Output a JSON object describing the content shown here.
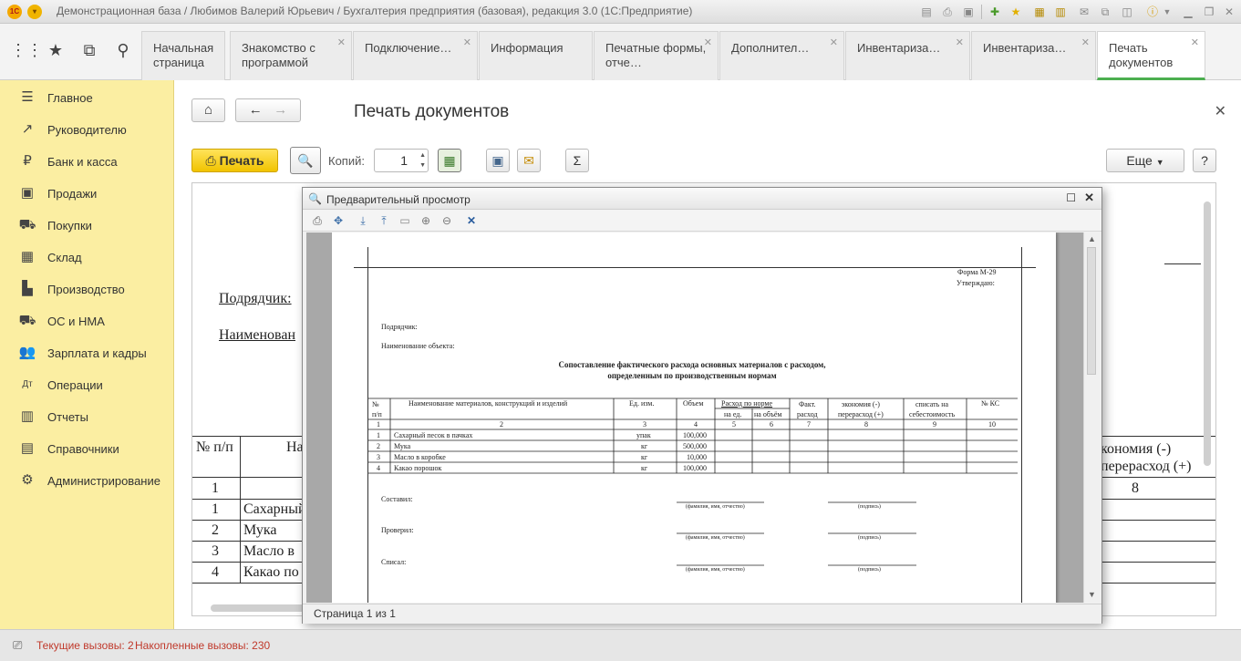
{
  "window": {
    "title": "Демонстрационная база / Любимов Валерий Юрьевич / Бухгалтерия предприятия (базовая), редакция 3.0  (1С:Предприятие)",
    "logo": "1С"
  },
  "tabs": [
    {
      "label": "Начальная страница",
      "closable": false
    },
    {
      "label": "Знакомство с программой",
      "closable": true
    },
    {
      "label": "Подключение…",
      "closable": true
    },
    {
      "label": "Информация",
      "closable": false
    },
    {
      "label": "Печатные формы, отче…",
      "closable": true
    },
    {
      "label": "Дополнител…",
      "closable": true
    },
    {
      "label": "Инвентариза…",
      "closable": true
    },
    {
      "label": "Инвентариза…",
      "closable": true
    },
    {
      "label": "Печать документов",
      "closable": true,
      "active": true
    }
  ],
  "sidebar": {
    "items": [
      {
        "label": "Главное",
        "icon": "menu-lines-icon"
      },
      {
        "label": "Руководителю",
        "icon": "trend-icon"
      },
      {
        "label": "Банк и касса",
        "icon": "ruble-icon"
      },
      {
        "label": "Продажи",
        "icon": "bag-icon"
      },
      {
        "label": "Покупки",
        "icon": "cart-icon"
      },
      {
        "label": "Склад",
        "icon": "warehouse-icon"
      },
      {
        "label": "Производство",
        "icon": "factory-icon"
      },
      {
        "label": "ОС и НМА",
        "icon": "truck-icon"
      },
      {
        "label": "Зарплата и кадры",
        "icon": "people-icon"
      },
      {
        "label": "Операции",
        "icon": "debit-credit-icon"
      },
      {
        "label": "Отчеты",
        "icon": "chart-icon"
      },
      {
        "label": "Справочники",
        "icon": "book-icon"
      },
      {
        "label": "Администрирование",
        "icon": "gear-icon"
      }
    ]
  },
  "form": {
    "title": "Печать документов",
    "print_label": "Печать",
    "copies_label": "Копий:",
    "copies_value": "1",
    "more_label": "Еще",
    "help_label": "?",
    "sum_symbol": "Σ"
  },
  "background_doc": {
    "contractor": "Подрядчик:",
    "object_name": "Наименован",
    "col_num": "№  п/п",
    "col_name": "На",
    "col_econ": "кономия (-)\nперерасход (+)",
    "col_econ_num": "8",
    "rows": [
      {
        "num": "1",
        "name": ""
      },
      {
        "num": "1",
        "name": "Сахарный"
      },
      {
        "num": "2",
        "name": "Мука"
      },
      {
        "num": "3",
        "name": "Масло в"
      },
      {
        "num": "4",
        "name": "Какао по"
      }
    ]
  },
  "preview": {
    "title": "Предварительный просмотр",
    "status": "Страница 1 из 1",
    "doc": {
      "form_code": "Форма М-29",
      "approve": "Утверждаю:",
      "contractor": "Подрядчик:",
      "object": "Наименование объекта:",
      "heading1": "Сопоставление фактического расхода основных материалов с расходом,",
      "heading2": "определенным по производственным нормам",
      "headers": {
        "num": "№\nп/п",
        "name": "Наименование материалов, конструкций и изделий",
        "unit": "Ед. изм.",
        "volume": "Объем",
        "norm": "Расход по норме",
        "per_unit": "на ед.",
        "per_volume": "на объём",
        "fact": "Факт.\nрасход",
        "econ": "экономия (-)\nперерасход (+)",
        "writeoff": "списать на\nсебестоимость",
        "ks": "№ КС"
      },
      "col_numbers": [
        "1",
        "2",
        "3",
        "4",
        "5",
        "6",
        "7",
        "8",
        "9",
        "10"
      ],
      "rows": [
        {
          "num": "1",
          "name": "Сахарный песок в пачках",
          "unit": "упак",
          "volume": "100,000"
        },
        {
          "num": "2",
          "name": "Мука",
          "unit": "кг",
          "volume": "500,000"
        },
        {
          "num": "3",
          "name": "Масло в коробке",
          "unit": "кг",
          "volume": "10,000"
        },
        {
          "num": "4",
          "name": "Какао порошок",
          "unit": "кг",
          "volume": "100,000"
        }
      ],
      "signatures": [
        {
          "label": "Составил:"
        },
        {
          "label": "Проверил:"
        },
        {
          "label": "Списал:"
        }
      ],
      "sig_fio": "(фамилия, имя, отчество)",
      "sig_sign": "(подпись)"
    }
  },
  "statusbar": {
    "current_calls": "Текущие вызовы: 2",
    "accumulated_calls": "Накопленные вызовы: 230"
  }
}
